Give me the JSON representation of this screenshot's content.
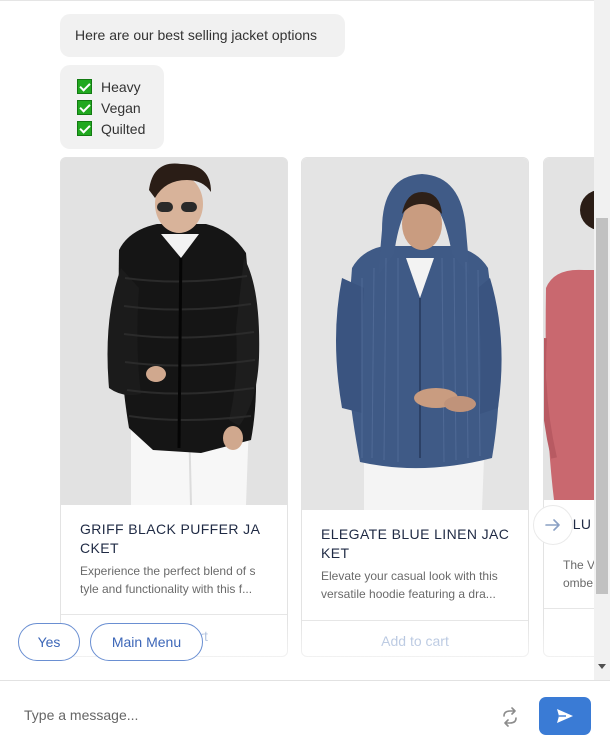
{
  "messages": {
    "intro": "Here are our best selling jacket options",
    "options": [
      {
        "label": "Heavy",
        "checked": true
      },
      {
        "label": "Vegan",
        "checked": true
      },
      {
        "label": "Quilted",
        "checked": true
      }
    ]
  },
  "products": [
    {
      "title": "GRIFF BLACK PUFFER JACKET",
      "desc_line1": "Experience the perfect blend of s",
      "desc_line2": "tyle and functionality with this f...",
      "button": "Add to cart"
    },
    {
      "title": "ELEGATE BLUE LINEN JACKET",
      "desc_line1": "Elevate your casual look with this",
      "desc_line2": "versatile hoodie featuring a dra...",
      "button": "Add to cart"
    },
    {
      "title": "ELU OMBE",
      "desc_line1": "The V",
      "desc_line2": "ombe"
    }
  ],
  "quick_replies": [
    "Yes",
    "Main Menu"
  ],
  "composer": {
    "placeholder": "Type a message...",
    "value": ""
  },
  "colors": {
    "accent": "#3a7bd5",
    "checkbox": "#21a81f",
    "quick_reply_border": "#6a8fd2"
  }
}
